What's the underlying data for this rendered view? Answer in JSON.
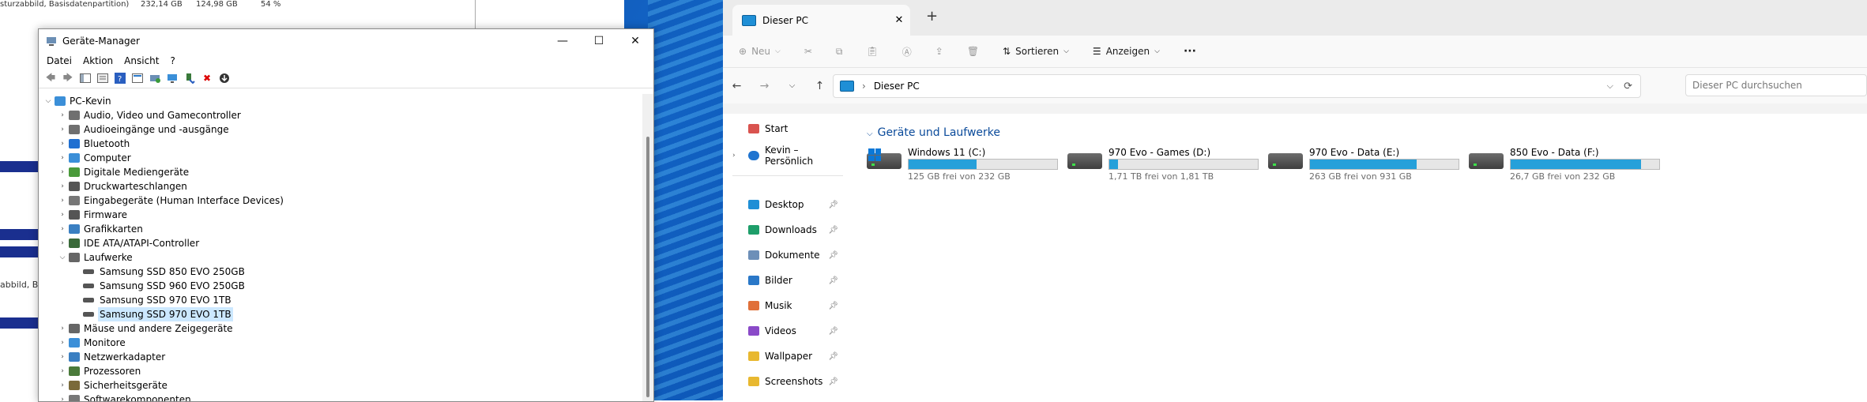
{
  "background_window": {
    "top_text": "sturzabbild, Basisdatenpartition)",
    "top_size1": "232,14 GB",
    "top_size2": "124,98 GB",
    "top_pct": "54 %",
    "snippet": "abbild, Ba"
  },
  "device_manager": {
    "title": "Geräte-Manager",
    "menu": [
      "Datei",
      "Aktion",
      "Ansicht",
      "?"
    ],
    "root": "PC-Kevin",
    "categories": [
      {
        "label": "Audio, Video und Gamecontroller",
        "color": "#6f6f6f"
      },
      {
        "label": "Audioeingänge und -ausgänge",
        "color": "#6f6f6f"
      },
      {
        "label": "Bluetooth",
        "color": "#1f6fd1"
      },
      {
        "label": "Computer",
        "color": "#3b8fd8"
      },
      {
        "label": "Digitale Mediengeräte",
        "color": "#4a9a3a"
      },
      {
        "label": "Druckwarteschlangen",
        "color": "#555555"
      },
      {
        "label": "Eingabegeräte (Human Interface Devices)",
        "color": "#777777"
      },
      {
        "label": "Firmware",
        "color": "#555555"
      },
      {
        "label": "Grafikkarten",
        "color": "#3a7fc2"
      },
      {
        "label": "IDE ATA/ATAPI-Controller",
        "color": "#3a6a3a"
      },
      {
        "label": "Laufwerke",
        "color": "#666666"
      }
    ],
    "drives": [
      "Samsung SSD 850 EVO 250GB",
      "Samsung SSD 960 EVO 250GB",
      "Samsung SSD 970 EVO 1TB",
      "Samsung SSD 970 EVO 1TB"
    ],
    "categories_after": [
      {
        "label": "Mäuse und andere Zeigegeräte",
        "color": "#666666"
      },
      {
        "label": "Monitore",
        "color": "#3b8fd8"
      },
      {
        "label": "Netzwerkadapter",
        "color": "#3a7fc2"
      },
      {
        "label": "Prozessoren",
        "color": "#4a7a3a"
      },
      {
        "label": "Sicherheitsgeräte",
        "color": "#7a6a3a"
      },
      {
        "label": "Softwarekomponenten",
        "color": "#777777"
      }
    ]
  },
  "explorer": {
    "tab_title": "Dieser PC",
    "toolbar": {
      "new": "Neu",
      "sort": "Sortieren",
      "view": "Anzeigen",
      "more": "···"
    },
    "address": "Dieser PC",
    "search_placeholder": "Dieser PC durchsuchen",
    "nav": {
      "home": "Start",
      "onedrive": "Kevin – Persönlich",
      "pinned": [
        {
          "label": "Desktop",
          "color": "#1f8fd6"
        },
        {
          "label": "Downloads",
          "color": "#1e9e6a"
        },
        {
          "label": "Dokumente",
          "color": "#6d8fb8"
        },
        {
          "label": "Bilder",
          "color": "#2a78c8"
        },
        {
          "label": "Musik",
          "color": "#e0703a"
        },
        {
          "label": "Videos",
          "color": "#8a4ac8"
        },
        {
          "label": "Wallpaper",
          "color": "#e8b830"
        },
        {
          "label": "Screenshots",
          "color": "#e8b830"
        }
      ]
    },
    "group_title": "Geräte und Laufwerke",
    "drives": [
      {
        "name": "Windows 11 (C:)",
        "free": "125 GB frei von 232 GB",
        "used_fraction": 0.46,
        "system": true
      },
      {
        "name": "970 Evo - Games (D:)",
        "free": "1,71 TB frei von 1,81 TB",
        "used_fraction": 0.06,
        "system": false
      },
      {
        "name": "970 Evo - Data (E:)",
        "free": "263 GB frei von 931 GB",
        "used_fraction": 0.72,
        "system": false
      },
      {
        "name": "850 Evo - Data (F:)",
        "free": "26,7 GB frei von 232 GB",
        "used_fraction": 0.88,
        "system": false
      }
    ]
  }
}
